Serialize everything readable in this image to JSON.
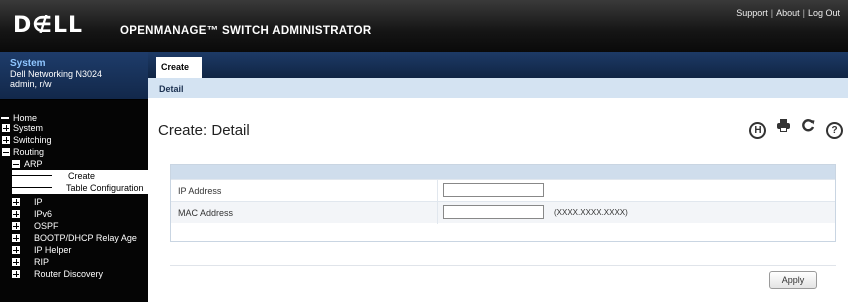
{
  "header": {
    "logo": "D∉LL",
    "title": "OPENMANAGE™ SWITCH ADMINISTRATOR",
    "links": [
      "Support",
      "About",
      "Log Out"
    ]
  },
  "system": {
    "title": "System",
    "model": "Dell Networking N3024",
    "user": "admin, r/w"
  },
  "nav": {
    "home": "Home",
    "system": "System",
    "switching": "Switching",
    "routing": "Routing",
    "arp": "ARP",
    "create": "Create",
    "table_config": "Table Configuration",
    "ip": "IP",
    "ipv6": "IPv6",
    "ospf": "OSPF",
    "bootp": "BOOTP/DHCP Relay Age",
    "ip_helper": "IP Helper",
    "rip": "RIP",
    "router_discovery": "Router Discovery"
  },
  "tabs": {
    "active": "Create"
  },
  "subtab": "Detail",
  "page": {
    "title": "Create: Detail"
  },
  "toolbar_icons": [
    "help-H-icon",
    "print-icon",
    "refresh-icon",
    "question-icon"
  ],
  "form": {
    "ip_label": "IP Address",
    "ip_value": "",
    "mac_label": "MAC Address",
    "mac_value": "",
    "mac_hint": "(XXXX.XXXX.XXXX)"
  },
  "apply_label": "Apply"
}
